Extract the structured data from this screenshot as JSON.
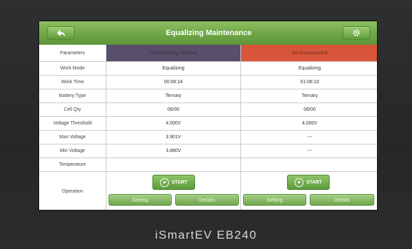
{
  "header": {
    "title": "Equalizing Maintenance",
    "back_icon": "back-arrow-icon",
    "settings_icon": "gear-icon"
  },
  "table": {
    "columns": [
      "Parameters",
      "1#:Equalizing Finished",
      "2#:Unconnected"
    ],
    "rows": [
      {
        "label": "Work Mode",
        "v1": "Equalizing",
        "v2": "Equalizing"
      },
      {
        "label": "Work Time",
        "v1": "00:06:24",
        "v2": "01:08:10"
      },
      {
        "label": "Battery Type",
        "v1": "Ternary",
        "v2": "Ternary"
      },
      {
        "label": "Cell Qty",
        "v1": "06/00",
        "v2": "06/00"
      },
      {
        "label": "Voltage Threshold",
        "v1": "4.000V",
        "v2": "4.000V"
      },
      {
        "label": "Max Voltage",
        "v1": "3.901V",
        "v2": "---"
      },
      {
        "label": "Min Voltage",
        "v1": "3.880V",
        "v2": "---"
      },
      {
        "label": "Temperature",
        "v1": "",
        "v2": ""
      }
    ],
    "operation_label": "Operation"
  },
  "channel1": {
    "start_label": "START",
    "setting_label": "Setting",
    "details_label": "Details"
  },
  "channel2": {
    "start_label": "START",
    "setting_label": "Setting",
    "details_label": "Details"
  },
  "brand": "iSmartEV EB240",
  "colors": {
    "header_green": "#6ea646",
    "channel1_header": "#5a4f6a",
    "channel2_header": "#d8553a"
  }
}
